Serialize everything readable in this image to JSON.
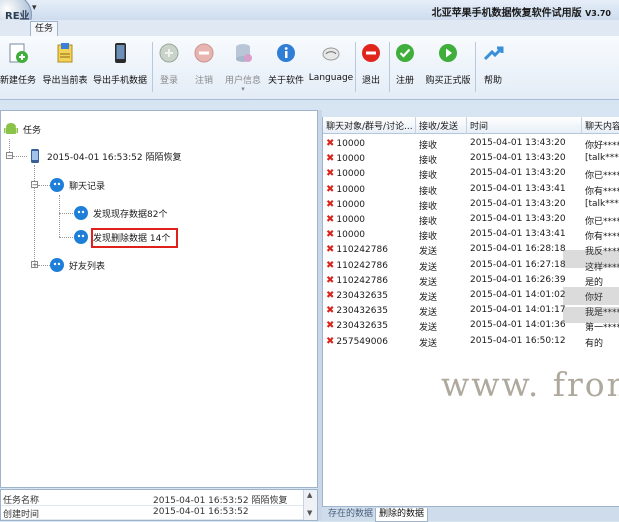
{
  "window": {
    "title": "北亚苹果手机数据恢复软件试用版",
    "version": "V3.70",
    "logo_text": "RE业"
  },
  "tabs": {
    "main": "任务"
  },
  "ribbon": [
    {
      "label": "新建任务",
      "icon": "new-task-icon",
      "disabled": false
    },
    {
      "label": "导出当前表",
      "icon": "export-table-icon",
      "disabled": false
    },
    {
      "label": "导出手机数据",
      "icon": "export-phone-icon",
      "disabled": false
    },
    {
      "label": "登录",
      "icon": "login-icon",
      "disabled": true
    },
    {
      "label": "注销",
      "icon": "logout-icon",
      "disabled": true
    },
    {
      "label": "用户信息",
      "icon": "user-info-icon",
      "disabled": true
    },
    {
      "label": "关于软件",
      "icon": "about-icon",
      "disabled": false
    },
    {
      "label": "Language",
      "icon": "language-icon",
      "disabled": false
    },
    {
      "label": "退出",
      "icon": "exit-icon",
      "disabled": false
    },
    {
      "label": "注册",
      "icon": "register-icon",
      "disabled": false
    },
    {
      "label": "购买正式版",
      "icon": "buy-icon",
      "disabled": false
    },
    {
      "label": "帮助",
      "icon": "help-icon",
      "disabled": false
    }
  ],
  "tree": {
    "root": "任务",
    "session": "2015-04-01 16:53:52 陌陌恢复",
    "chat_records": "聊天记录",
    "found_existing": "发现现存数据82个",
    "found_deleted": "发现删除数据 14个",
    "friends": "好友列表"
  },
  "grid": {
    "columns": [
      "聊天对象/群号/讨论...",
      "接收/发送",
      "时间",
      "聊天内容"
    ],
    "rows": [
      [
        "10000",
        "接收",
        "2015-04-01 13:43:20",
        "你好****"
      ],
      [
        "10000",
        "接收",
        "2015-04-01 13:43:20",
        "[talk****"
      ],
      [
        "10000",
        "接收",
        "2015-04-01 13:43:20",
        "你已****"
      ],
      [
        "10000",
        "接收",
        "2015-04-01 13:43:41",
        "你有****"
      ],
      [
        "10000",
        "接收",
        "2015-04-01 13:43:20",
        "[talk****"
      ],
      [
        "10000",
        "接收",
        "2015-04-01 13:43:20",
        "你已****"
      ],
      [
        "10000",
        "接收",
        "2015-04-01 13:43:41",
        "你有****"
      ],
      [
        "110242786",
        "发送",
        "2015-04-01 16:28:18",
        "我反****"
      ],
      [
        "110242786",
        "发送",
        "2015-04-01 16:27:18",
        "这样****"
      ],
      [
        "110242786",
        "发送",
        "2015-04-01 16:26:39",
        "是的"
      ],
      [
        "230432635",
        "发送",
        "2015-04-01 14:01:02",
        "你好"
      ],
      [
        "230432635",
        "发送",
        "2015-04-01 14:01:17",
        "我是****"
      ],
      [
        "230432635",
        "发送",
        "2015-04-01 14:01:36",
        "第一****"
      ],
      [
        "257549006",
        "发送",
        "2015-04-01 16:50:12",
        "有的"
      ]
    ]
  },
  "watermark": "www. fron",
  "bottom_tabs": [
    "存在的数据",
    "删除的数据"
  ],
  "properties": [
    [
      "任务名称",
      "2015-04-01  16:53:52  陌陌恢复"
    ],
    [
      "创建时间",
      "2015-04-01  16:53:52"
    ]
  ],
  "colors": {
    "accent": "#d9251d",
    "ribbon_bg": "#e3ecf6",
    "frame": "#d7e4f2"
  }
}
